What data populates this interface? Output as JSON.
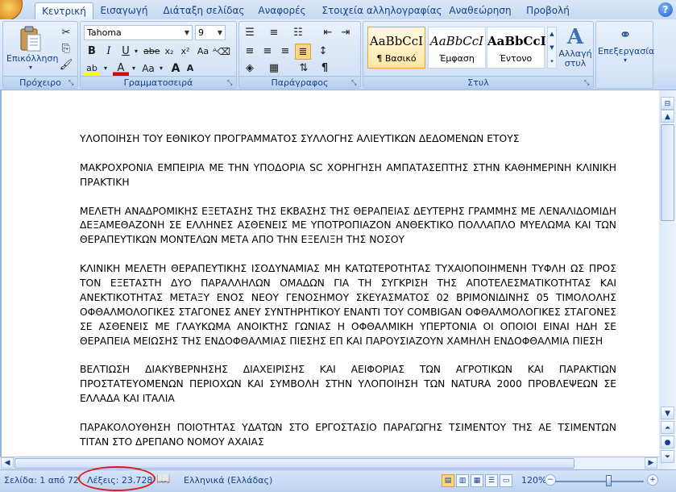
{
  "tabs": [
    {
      "label": "Κεντρική",
      "active": true
    },
    {
      "label": "Εισαγωγή",
      "active": false
    },
    {
      "label": "Διάταξη σελίδας",
      "active": false
    },
    {
      "label": "Αναφορές",
      "active": false
    },
    {
      "label": "Στοιχεία αλληλογραφίας",
      "active": false
    },
    {
      "label": "Αναθεώρηση",
      "active": false
    },
    {
      "label": "Προβολή",
      "active": false
    }
  ],
  "ribbon": {
    "clipboard": {
      "group_label": "Πρόχειρο",
      "paste_label": "Επικόλληση"
    },
    "font": {
      "group_label": "Γραμματοσειρά",
      "font_name": "Tahoma",
      "font_size": "9"
    },
    "paragraph": {
      "group_label": "Παράγραφος"
    },
    "styles": {
      "group_label": "Στυλ",
      "items": [
        {
          "preview": "AaBbCcI",
          "name": "¶ Βασικό"
        },
        {
          "preview": "AaBbCcI",
          "name": "Έμφαση"
        },
        {
          "preview": "AaBbCcI",
          "name": "Έντονο"
        }
      ],
      "change_styles_label": "Αλλαγή στυλ"
    },
    "editing": {
      "label": "Επεξεργασία"
    }
  },
  "document": {
    "paragraphs": [
      "ΥΛΟΠΟΙΗΣΗ ΤΟΥ ΕΘΝΙΚΟΥ ΠΡΟΓΡΑΜΜΑΤΟΣ ΣΥΛΛΟΓΗΣ ΑΛΙΕΥΤΙΚΩΝ ΔΕΔΟΜΕΝΩΝ ΕΤΟΥΣ",
      "ΜΑΚΡΟΧΡΟΝΙΑ ΕΜΠΕΙΡΙΑ ΜΕ ΤΗΝ ΥΠΟΔΟΡΙΑ SC ΧΟΡΗΓΗΣΗ ΑΜΠΑΤΑΣΕΠΤΗΣ ΣΤΗΝ ΚΑΘΗΜΕΡΙΝΗ ΚΛΙΝΙΚΗ ΠΡΑΚΤΙΚΗ",
      "ΜΕΛΕΤΗ ΑΝΑΔΡΟΜΙΚΗΣ ΕΞΕΤΑΣΗΣ ΤΗΣ ΕΚΒΑΣΗΣ ΤΗΣ ΘΕΡΑΠΕΙΑΣ ΔΕΥΤΕΡΗΣ ΓΡΑΜΜΗΣ ΜΕ ΛΕΝΑΛΙΔΟΜΙΔΗ ΔΕΞΑΜΕΘΑΖΟΝΗ ΣΕ ΕΛΛΗΝΕΣ ΑΣΘΕΝΕΙΣ ΜΕ ΥΠΟΤΡΟΠΙΑΖΟΝ ΑΝΘΕΚΤΙΚΟ ΠΟΛΛΑΠΛΟ ΜΥΕΛΩΜΑ ΚΑΙ ΤΩΝ ΘΕΡΑΠΕΥΤΙΚΩΝ ΜΟΝΤΕΛΩΝ ΜΕΤΑ ΑΠΟ ΤΗΝ ΕΞΕΛΙΞΗ ΤΗΣ ΝΟΣΟΥ",
      "ΚΛΙΝΙΚΗ ΜΕΛΕΤΗ ΘΕΡΑΠΕΥΤΙΚΗΣ ΙΣΟΔΥΝΑΜΙΑΣ ΜΗ ΚΑΤΩΤΕΡΟΤΗΤΑΣ ΤΥΧΑΙΟΠΟΙΗΜΕΝΗ ΤΥΦΛΗ ΩΣ ΠΡΟΣ ΤΟΝ ΕΞΕΤΑΣΤΗ ΔΥΟ ΠΑΡΑΛΛΗΛΩΝ ΟΜΑΔΩΝ ΓΙΑ ΤΗ ΣΥΓΚΡΙΣΗ ΤΗΣ ΑΠΟΤΕΛΕΣΜΑΤΙΚΟΤΗΤΑΣ ΚΑΙ ΑΝΕΚΤΙΚΟΤΗΤΑΣ ΜΕΤΑΞΥ ΕΝΟΣ ΝΕΟΥ ΓΕΝΟΣΗΜΟΥ ΣΚΕΥΑΣΜΑΤΟΣ 02 ΒΡΙΜΟΝΙΔΙΝΗΣ 05 ΤΙΜΟΛΟΛΗΣ ΟΦΘΑΛΜΟΛΟΓΙΚΕΣ ΣΤΑΓΟΝΕΣ ΑΝΕΥ ΣΥΝΤΗΡΗΤΙΚΟΥ ΕΝΑΝΤΙ ΤΟΥ COMBIGAN ΟΦΘΑΛΜΟΛΟΓΙΚΕΣ ΣΤΑΓΟΝΕΣ ΣΕ ΑΣΘΕΝΕΙΣ ΜΕ ΓΛΑΥΚΩΜΑ ΑΝΟΙΚΤΗΣ ΓΩΝΙΑΣ Η ΟΦΘΑΛΜΙΚΗ ΥΠΕΡΤΟΝΙΑ ΟΙ ΟΠΟΙΟΙ ΕΙΝΑΙ ΗΔΗ ΣΕ ΘΕΡΑΠΕΙΑ ΜΕΙΩΣΗΣ ΤΗΣ ΕΝΔΟΦΘΑΛΜΙΑΣ ΠΙΕΣΗΣ ΕΠ ΚΑΙ ΠΑΡΟΥΣΙΑΖΟΥΝ ΧΑΜΗΛΗ ΕΝΔΟΦΘΑΛΜΙΑ ΠΙΕΣΗ",
      "ΒΕΛΤΙΩΣΗ ΔΙΑΚΥΒΕΡΝΗΣΗΣ ΔΙΑΧΕΙΡΙΣΗΣ ΚΑΙ ΑΕΙΦΟΡΙΑΣ ΤΩΝ ΑΓΡΟΤΙΚΩΝ ΚΑΙ ΠΑΡΑΚΤΙΩΝ ΠΡΟΣΤΑΤΕΥΟΜΕΝΩΝ ΠΕΡΙΟΧΩΝ ΚΑΙ ΣΥΜΒΟΛΗ ΣΤΗΝ ΥΛΟΠΟΙΗΣΗ ΤΩΝ NATURA 2000 ΠΡΟΒΛΕΨΕΩΝ ΣΕ ΕΛΛΑΔΑ ΚΑΙ ΙΤΑΛΙΑ",
      "ΠΑΡΑΚΟΛΟΥΘΗΣΗ ΠΟΙΟΤΗΤΑΣ ΥΔΑΤΩΝ ΣΤΟ ΕΡΓΟΣΤΑΣΙΟ ΠΑΡΑΓΩΓΗΣ ΤΣΙΜΕΝΤΟΥ ΤΗΣ ΑΕ ΤΣΙΜΕΝΤΩΝ ΤΙΤΑΝ ΣΤΟ ΔΡΕΠΑΝΟ ΝΟΜΟΥ ΑΧΑΙΑΣ"
    ]
  },
  "status": {
    "page": "Σελίδα: 1 από 72",
    "words": "Λέξεις: 23.728",
    "language": "Ελληνικά (Ελλάδας)",
    "zoom": "120%"
  },
  "colors": {
    "accent": "#15428b",
    "highlight_circle": "#d91e1e"
  }
}
